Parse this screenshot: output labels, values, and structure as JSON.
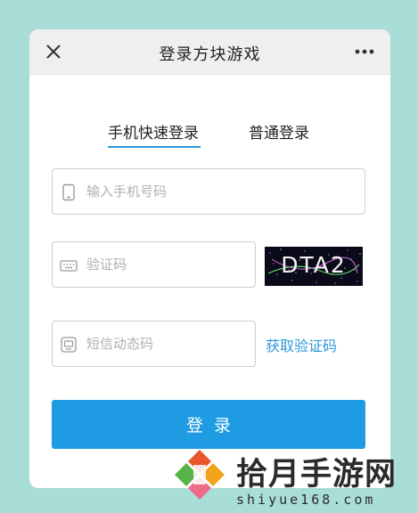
{
  "header": {
    "title": "登录方块游戏",
    "close_icon": "close-icon",
    "more_icon": "more-icon"
  },
  "tabs": [
    {
      "label": "手机快速登录",
      "active": true
    },
    {
      "label": "普通登录",
      "active": false
    }
  ],
  "form": {
    "phone": {
      "placeholder": "输入手机号码",
      "value": "",
      "icon": "phone-icon"
    },
    "captcha": {
      "placeholder": "验证码",
      "value": "",
      "icon": "keyboard-icon",
      "image_text": "DTA2"
    },
    "sms": {
      "placeholder": "短信动态码",
      "value": "",
      "icon": "message-icon"
    },
    "get_code_label": "获取验证码",
    "submit_label": "登录"
  },
  "watermark": {
    "name": "拾月手游网",
    "url": "shiyue168.com"
  },
  "colors": {
    "background": "#a9ddd7",
    "accent": "#2f97d8",
    "button": "#1f9be4",
    "titlebar": "#efefef"
  }
}
